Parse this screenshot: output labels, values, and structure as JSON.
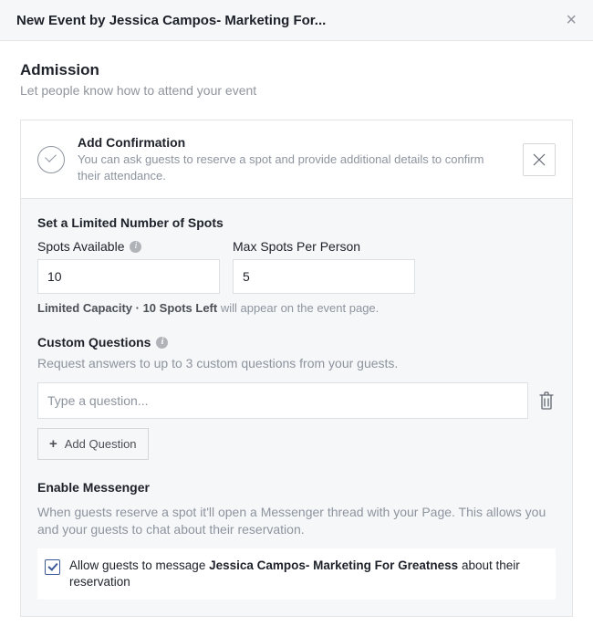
{
  "header": {
    "title": "New Event by Jessica Campos- Marketing For..."
  },
  "admission": {
    "heading": "Admission",
    "sub": "Let people know how to attend your event"
  },
  "confirmation": {
    "title": "Add Confirmation",
    "desc": "You can ask guests to reserve a spot and provide additional details to confirm their attendance."
  },
  "spots": {
    "heading": "Set a Limited Number of Spots",
    "available_label": "Spots Available",
    "available_value": "10",
    "max_label": "Max Spots Per Person",
    "max_value": "5",
    "hint_bold": "Limited Capacity · 10 Spots Left",
    "hint_rest": " will appear on the event page."
  },
  "questions": {
    "heading": "Custom Questions",
    "desc": "Request answers to up to 3 custom questions from your guests.",
    "placeholder": "Type a question...",
    "add_label": "Add Question"
  },
  "messenger": {
    "heading": "Enable Messenger",
    "desc": "When guests reserve a spot it'll open a Messenger thread with your Page. This allows you and your guests to chat about their reservation.",
    "check_pre": "Allow guests to message ",
    "check_bold": "Jessica Campos- Marketing For Greatness",
    "check_post": " about their reservation"
  }
}
